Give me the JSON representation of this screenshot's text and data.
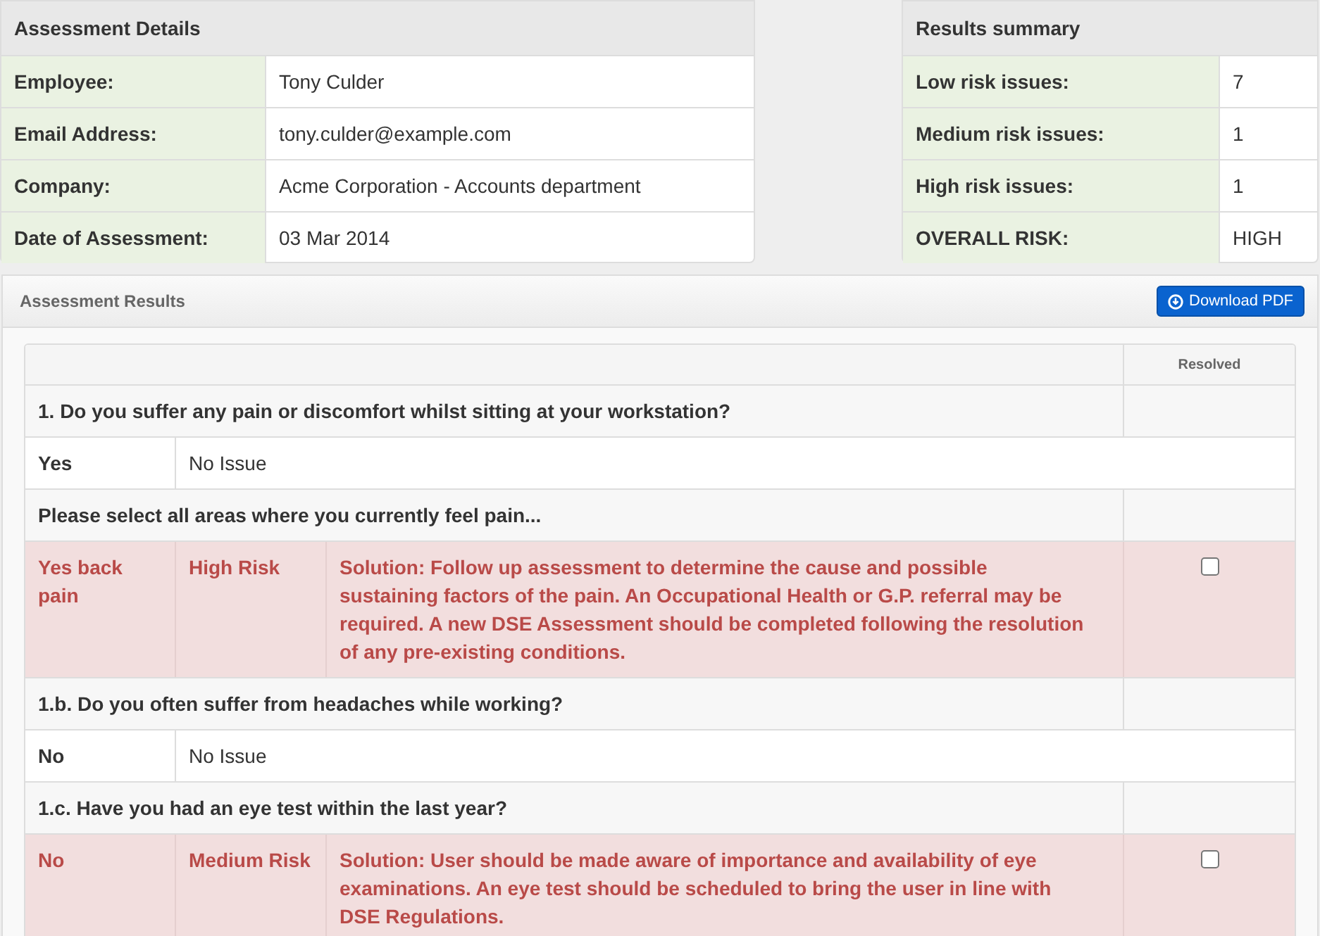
{
  "details": {
    "title": "Assessment Details",
    "rows": [
      {
        "label": "Employee:",
        "value": "Tony Culder"
      },
      {
        "label": "Email Address:",
        "value": "tony.culder@example.com"
      },
      {
        "label": "Company:",
        "value": "Acme Corporation - Accounts department"
      },
      {
        "label": "Date of Assessment:",
        "value": "03 Mar 2014"
      }
    ]
  },
  "summary": {
    "title": "Results summary",
    "rows": [
      {
        "label": "Low risk issues:",
        "value": "7"
      },
      {
        "label": "Medium risk issues:",
        "value": "1"
      },
      {
        "label": "High risk issues:",
        "value": "1"
      },
      {
        "label": "OVERALL RISK:",
        "value": "HIGH"
      }
    ]
  },
  "results": {
    "title": "Assessment Results",
    "download_button": "Download PDF",
    "resolved_header": "Resolved",
    "rows": [
      {
        "kind": "question",
        "text": "1. Do you suffer any pain or discomfort whilst sitting at your workstation?"
      },
      {
        "kind": "answer",
        "answer": "Yes",
        "risk": "No Issue"
      },
      {
        "kind": "question",
        "text": "Please select all areas where you currently feel pain..."
      },
      {
        "kind": "issue",
        "answer": "Yes back pain",
        "risk": "High Risk",
        "solution": "Solution: Follow up assessment to determine the cause and possible sustaining factors of the pain. An Occupational Health or G.P. referral may be required. A new DSE Assessment should be completed following the resolution of any pre-existing conditions.",
        "checked": false
      },
      {
        "kind": "question",
        "text": "1.b. Do you often suffer from headaches while working?"
      },
      {
        "kind": "answer",
        "answer": "No",
        "risk": "No Issue"
      },
      {
        "kind": "question",
        "text": "1.c. Have you had an eye test within the last year?"
      },
      {
        "kind": "issue",
        "answer": "No",
        "risk": "Medium Risk",
        "solution": "Solution: User should be made aware of importance and availability of eye examinations. An eye test should be scheduled to bring the user in line with DSE Regulations.",
        "checked": false
      }
    ]
  }
}
